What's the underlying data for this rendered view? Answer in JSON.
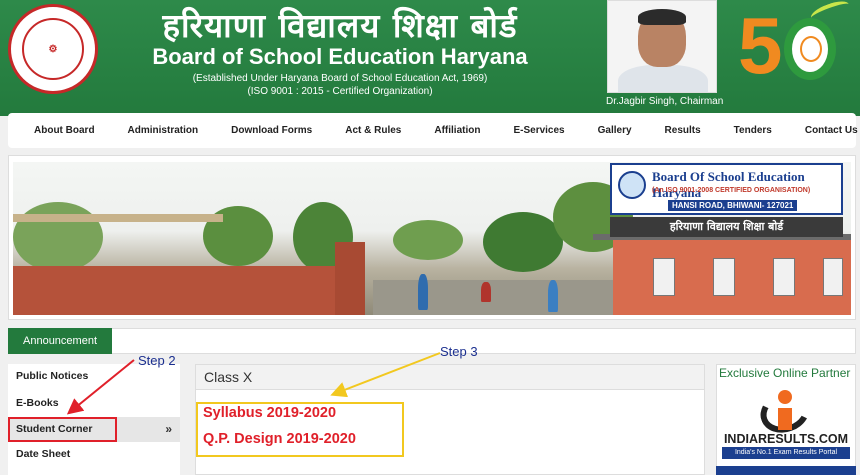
{
  "header": {
    "logo_text": "हरियाणा विद्यालय शिक्षा बोर्ड",
    "title_hindi": "हरियाणा विद्यालय शिक्षा बोर्ड",
    "title_english": "Board of School Education Haryana",
    "established": "(Established Under Haryana Board of School Education Act, 1969)",
    "iso": "(ISO 9001 : 2015 - Certified Organization)",
    "chairman": "Dr.Jagbir Singh, Chairman",
    "anniversary": "50"
  },
  "nav": {
    "items": [
      "About Board",
      "Administration",
      "Download Forms",
      "Act & Rules",
      "Affiliation",
      "E-Services",
      "Gallery",
      "Results",
      "Tenders",
      "Contact Us"
    ]
  },
  "banner": {
    "sign_title": "Board Of School Education Haryana",
    "sign_sub": "(An ISO 9001-2008 CERTIFIED ORGANISATION)",
    "sign_address": "HANSI ROAD, BHIWANI- 127021",
    "hindi_sign": "हरियाणा विद्यालय शिक्षा बोर्ड"
  },
  "announcement": {
    "tab_label": "Announcement"
  },
  "sidebar": {
    "items": [
      "Public Notices",
      "E-Books",
      "Student Corner",
      "Date Sheet"
    ],
    "chevron": "»"
  },
  "main": {
    "heading": "Class X",
    "links": [
      "Syllabus 2019-2020",
      "Q.P. Design 2019-2020"
    ]
  },
  "steps": {
    "step2": "Step 2",
    "step3": "Step 3"
  },
  "right_panel": {
    "heading": "Exclusive Online Partner",
    "partner_name": "INDIARESULTS.COM",
    "partner_tagline": "India's No.1 Exam Results Portal"
  },
  "colors": {
    "brand_green": "#237a3d",
    "highlight_red": "#e0202a",
    "highlight_yellow": "#f2c81f",
    "annotation_blue": "#1b2f8f"
  }
}
